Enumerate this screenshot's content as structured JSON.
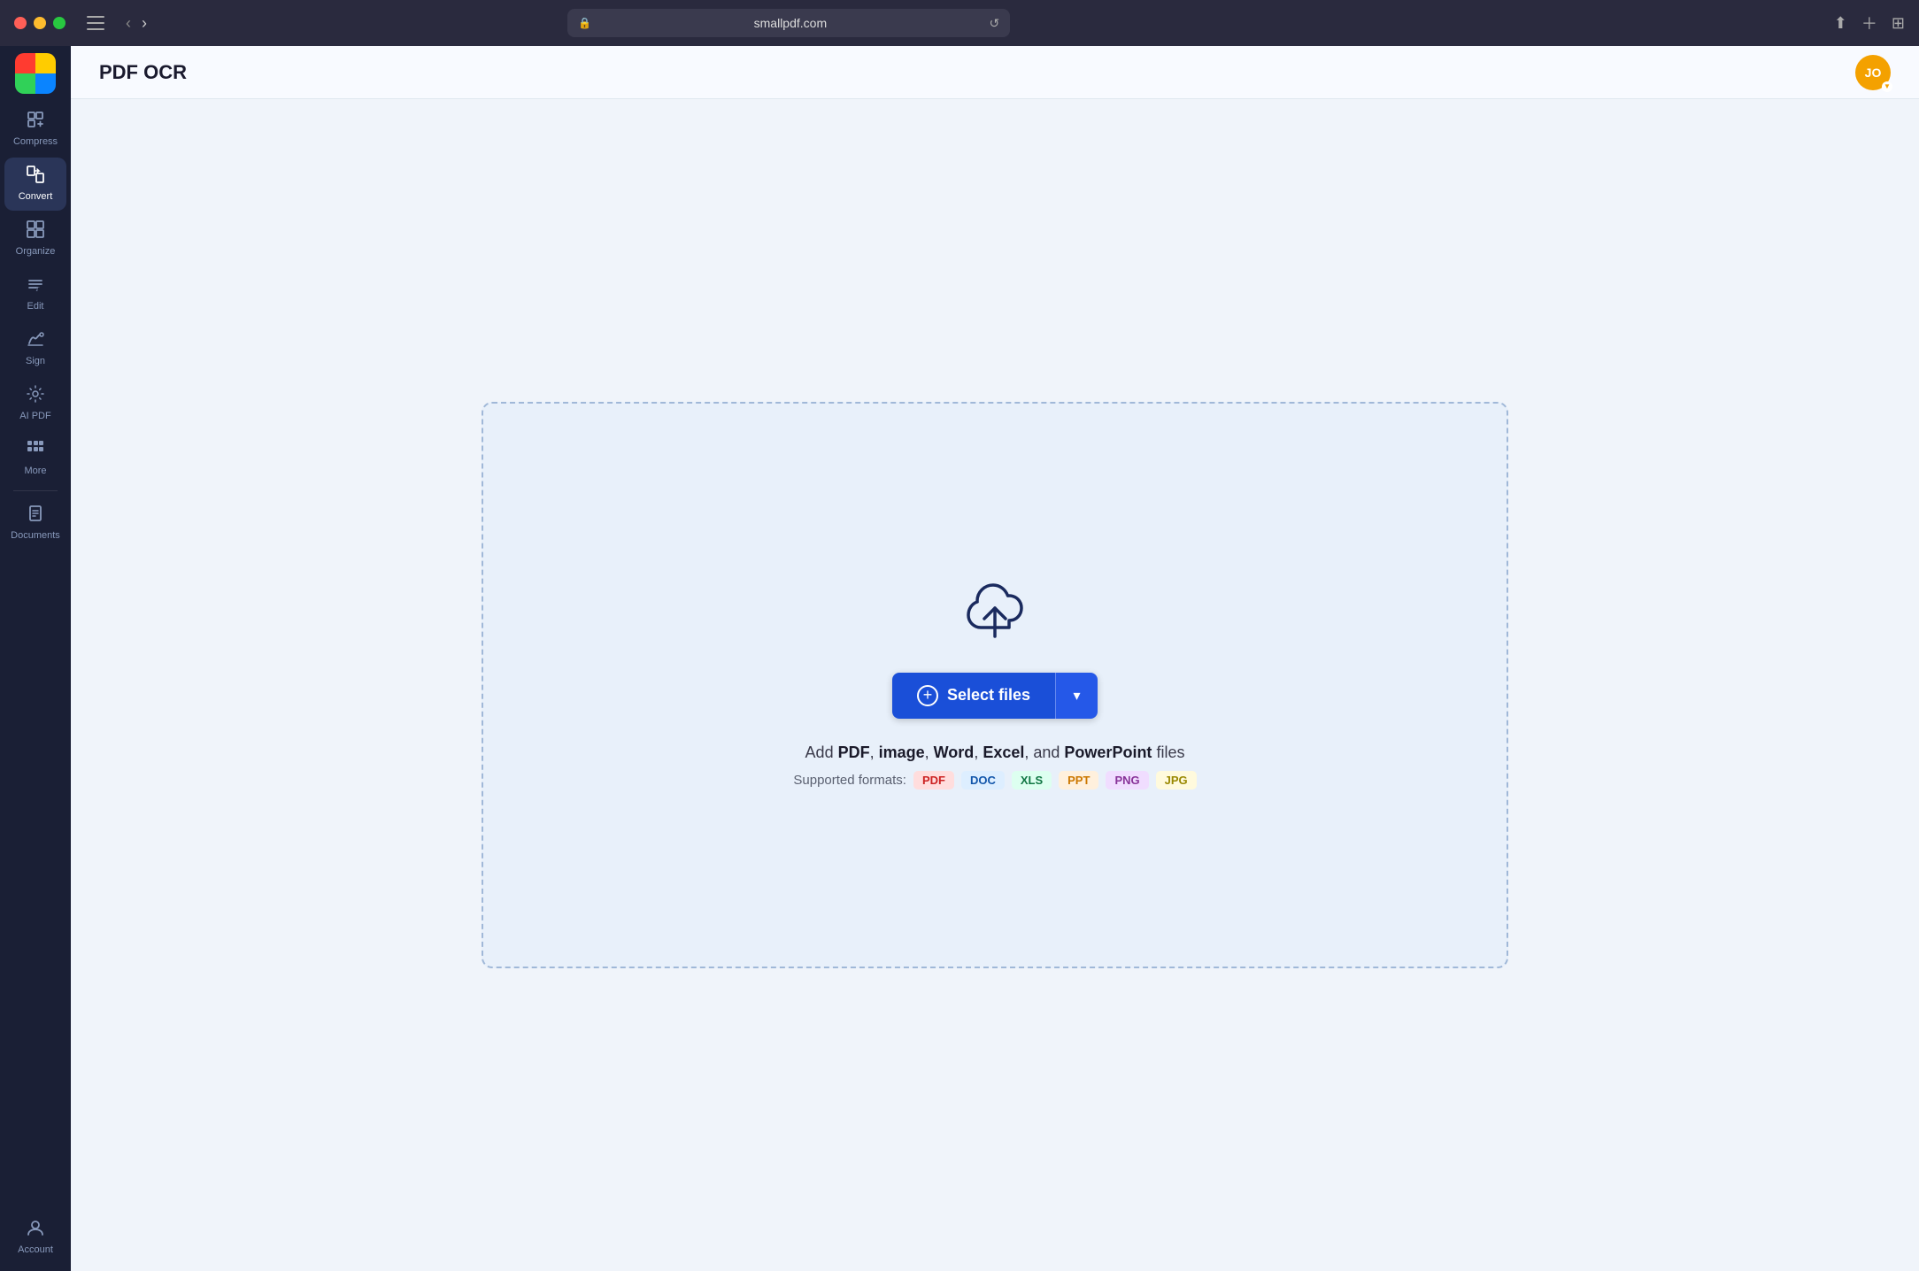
{
  "titleBar": {
    "url": "smallpdf.com",
    "lockIcon": "🔒",
    "reloadIcon": "↺"
  },
  "sidebar": {
    "logo": {
      "ariaLabel": "Smallpdf logo"
    },
    "items": [
      {
        "id": "compress",
        "label": "Compress",
        "icon": "compress"
      },
      {
        "id": "convert",
        "label": "Convert",
        "icon": "convert",
        "active": true
      },
      {
        "id": "organize",
        "label": "Organize",
        "icon": "organize"
      },
      {
        "id": "edit",
        "label": "Edit",
        "icon": "edit"
      },
      {
        "id": "sign",
        "label": "Sign",
        "icon": "sign"
      },
      {
        "id": "ai-pdf",
        "label": "AI PDF",
        "icon": "ai-pdf"
      },
      {
        "id": "more",
        "label": "More",
        "icon": "more"
      },
      {
        "id": "documents",
        "label": "Documents",
        "icon": "documents"
      },
      {
        "id": "account",
        "label": "Account",
        "icon": "account"
      }
    ]
  },
  "header": {
    "title": "PDF OCR",
    "userInitials": "JO"
  },
  "dropZone": {
    "selectFilesLabel": "Select files",
    "dropdownArrow": "▾",
    "fileInfoMain": "Add {PDF}, {image}, {Word}, {Excel}, and {PowerPoint} files",
    "formatsLabel": "Supported formats:",
    "formats": [
      {
        "id": "pdf",
        "label": "PDF",
        "class": "fmt-pdf"
      },
      {
        "id": "doc",
        "label": "DOC",
        "class": "fmt-doc"
      },
      {
        "id": "xls",
        "label": "XLS",
        "class": "fmt-xls"
      },
      {
        "id": "ppt",
        "label": "PPT",
        "class": "fmt-ppt"
      },
      {
        "id": "png",
        "label": "PNG",
        "class": "fmt-png"
      },
      {
        "id": "jpg",
        "label": "JPG",
        "class": "fmt-jpg"
      }
    ]
  }
}
